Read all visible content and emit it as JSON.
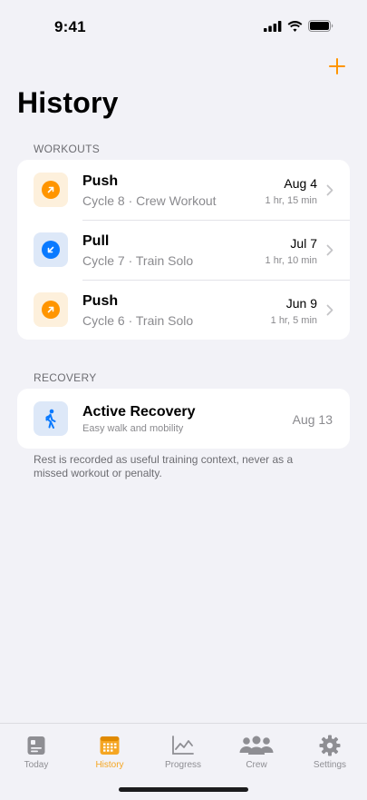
{
  "status_bar": {
    "time": "9:41"
  },
  "header": {
    "title": "History",
    "add_icon": "plus-icon"
  },
  "colors": {
    "accent": "#FF9500",
    "blue": "#0A7AFF",
    "background": "#F2F2F7"
  },
  "workouts": {
    "section_label": "WORKOUTS",
    "items": [
      {
        "title": "Push",
        "subtitle": "Cycle 8 · Crew Workout",
        "date": "Aug 4",
        "duration": "1 hr, 15 min",
        "icon": "arrow-up-right-icon",
        "color": "orange"
      },
      {
        "title": "Pull",
        "subtitle": "Cycle 7 · Train Solo",
        "date": "Jul 7",
        "duration": "1 hr, 10 min",
        "icon": "arrow-down-left-icon",
        "color": "blue"
      },
      {
        "title": "Push",
        "subtitle": "Cycle 6 · Train Solo",
        "date": "Jun 9",
        "duration": "1 hr, 5 min",
        "icon": "arrow-up-right-icon",
        "color": "orange"
      }
    ]
  },
  "recovery": {
    "section_label": "RECOVERY",
    "item": {
      "title": "Active Recovery",
      "subtitle": "Easy walk and mobility",
      "date": "Aug 13",
      "icon": "walking-figure-icon"
    },
    "footnote": "Rest is recorded as useful training context, never as a missed workout or penalty."
  },
  "tab_bar": {
    "active": "History",
    "tabs": [
      {
        "label": "Today",
        "icon": "today-card-icon"
      },
      {
        "label": "History",
        "icon": "calendar-grid-icon"
      },
      {
        "label": "Progress",
        "icon": "chart-line-icon"
      },
      {
        "label": "Crew",
        "icon": "people-icon"
      },
      {
        "label": "Settings",
        "icon": "gear-icon"
      }
    ]
  }
}
